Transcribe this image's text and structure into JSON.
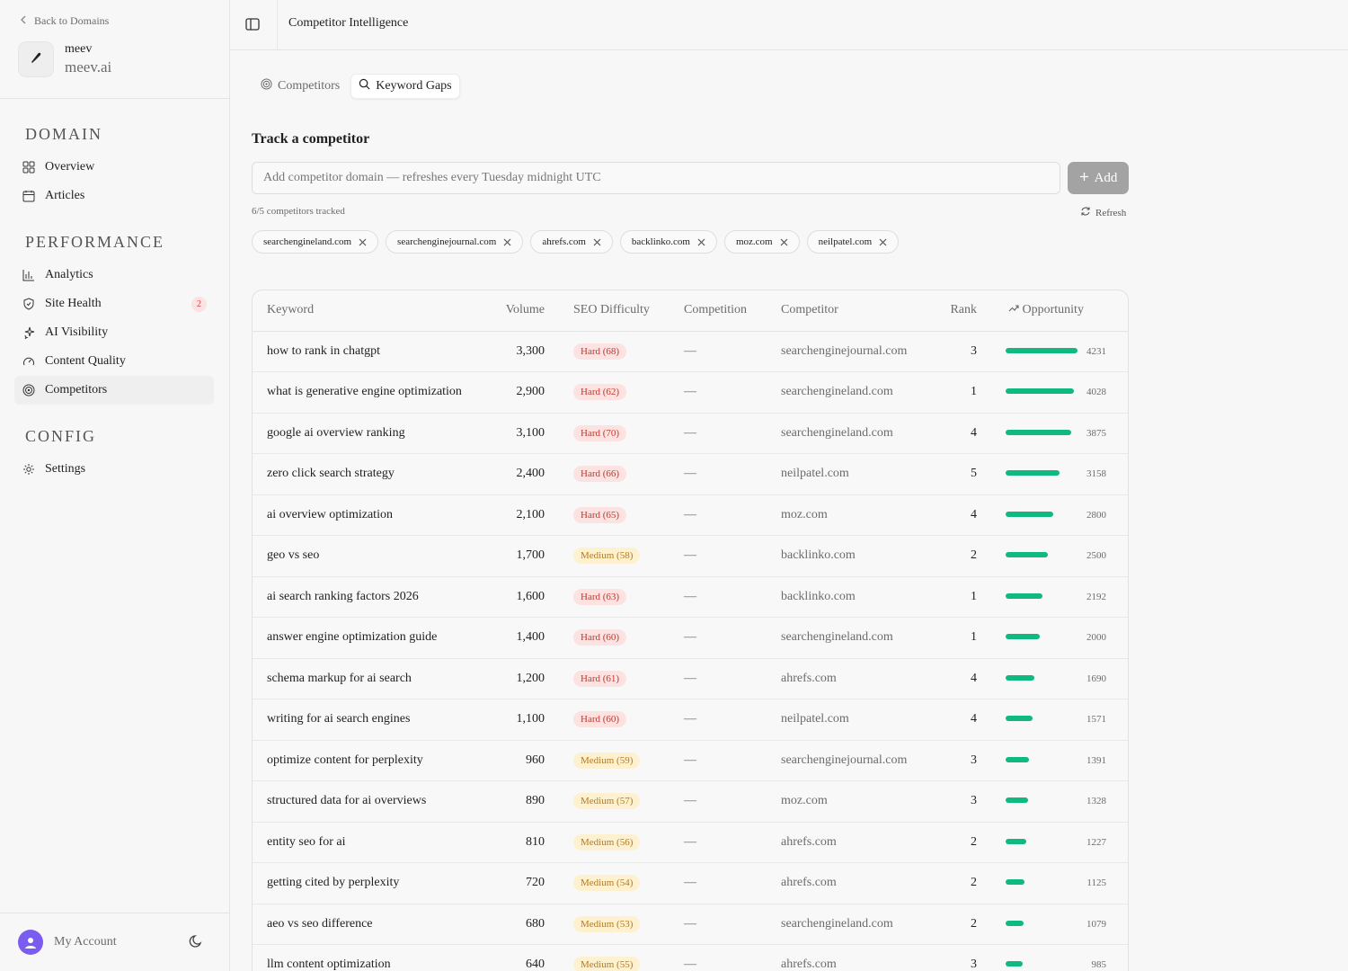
{
  "sidebar": {
    "back_label": "Back to Domains",
    "brand_name": "meev",
    "brand_domain": "meev.ai",
    "sections": {
      "domain": "DOMAIN",
      "performance": "PERFORMANCE",
      "config": "CONFIG"
    },
    "items": {
      "overview": "Overview",
      "articles": "Articles",
      "analytics": "Analytics",
      "site_health": "Site Health",
      "site_health_badge": "2",
      "ai_visibility": "AI Visibility",
      "content_quality": "Content Quality",
      "competitors": "Competitors",
      "settings": "Settings"
    },
    "account_label": "My Account"
  },
  "topbar": {
    "title": "Competitor Intelligence"
  },
  "tabs": {
    "competitors": "Competitors",
    "keyword_gaps": "Keyword Gaps",
    "active": "keyword_gaps"
  },
  "track": {
    "title": "Track a competitor",
    "placeholder": "Add competitor domain — refreshes every Tuesday midnight UTC",
    "add_label": "Add",
    "tracked_text": "6/5 competitors tracked",
    "refresh_label": "Refresh",
    "chips": [
      "searchengineland.com",
      "searchenginejournal.com",
      "ahrefs.com",
      "backlinko.com",
      "moz.com",
      "neilpatel.com"
    ]
  },
  "table": {
    "headers": {
      "keyword": "Keyword",
      "volume": "Volume",
      "seo_difficulty": "SEO Difficulty",
      "competition": "Competition",
      "competitor": "Competitor",
      "rank": "Rank",
      "opportunity": "Opportunity"
    },
    "opportunity_max": 4231,
    "rows": [
      {
        "keyword": "how to rank in chatgpt",
        "volume": "3,300",
        "difficulty": "Hard (68)",
        "level": "hard",
        "competition": "—",
        "competitor": "searchenginejournal.com",
        "rank": "3",
        "opportunity": 4231
      },
      {
        "keyword": "what is generative engine optimization",
        "volume": "2,900",
        "difficulty": "Hard (62)",
        "level": "hard",
        "competition": "—",
        "competitor": "searchengineland.com",
        "rank": "1",
        "opportunity": 4028
      },
      {
        "keyword": "google ai overview ranking",
        "volume": "3,100",
        "difficulty": "Hard (70)",
        "level": "hard",
        "competition": "—",
        "competitor": "searchengineland.com",
        "rank": "4",
        "opportunity": 3875
      },
      {
        "keyword": "zero click search strategy",
        "volume": "2,400",
        "difficulty": "Hard (66)",
        "level": "hard",
        "competition": "—",
        "competitor": "neilpatel.com",
        "rank": "5",
        "opportunity": 3158
      },
      {
        "keyword": "ai overview optimization",
        "volume": "2,100",
        "difficulty": "Hard (65)",
        "level": "hard",
        "competition": "—",
        "competitor": "moz.com",
        "rank": "4",
        "opportunity": 2800
      },
      {
        "keyword": "geo vs seo",
        "volume": "1,700",
        "difficulty": "Medium (58)",
        "level": "medium",
        "competition": "—",
        "competitor": "backlinko.com",
        "rank": "2",
        "opportunity": 2500
      },
      {
        "keyword": "ai search ranking factors 2026",
        "volume": "1,600",
        "difficulty": "Hard (63)",
        "level": "hard",
        "competition": "—",
        "competitor": "backlinko.com",
        "rank": "1",
        "opportunity": 2192
      },
      {
        "keyword": "answer engine optimization guide",
        "volume": "1,400",
        "difficulty": "Hard (60)",
        "level": "hard",
        "competition": "—",
        "competitor": "searchengineland.com",
        "rank": "1",
        "opportunity": 2000
      },
      {
        "keyword": "schema markup for ai search",
        "volume": "1,200",
        "difficulty": "Hard (61)",
        "level": "hard",
        "competition": "—",
        "competitor": "ahrefs.com",
        "rank": "4",
        "opportunity": 1690
      },
      {
        "keyword": "writing for ai search engines",
        "volume": "1,100",
        "difficulty": "Hard (60)",
        "level": "hard",
        "competition": "—",
        "competitor": "neilpatel.com",
        "rank": "4",
        "opportunity": 1571
      },
      {
        "keyword": "optimize content for perplexity",
        "volume": "960",
        "difficulty": "Medium (59)",
        "level": "medium",
        "competition": "—",
        "competitor": "searchenginejournal.com",
        "rank": "3",
        "opportunity": 1391
      },
      {
        "keyword": "structured data for ai overviews",
        "volume": "890",
        "difficulty": "Medium (57)",
        "level": "medium",
        "competition": "—",
        "competitor": "moz.com",
        "rank": "3",
        "opportunity": 1328
      },
      {
        "keyword": "entity seo for ai",
        "volume": "810",
        "difficulty": "Medium (56)",
        "level": "medium",
        "competition": "—",
        "competitor": "ahrefs.com",
        "rank": "2",
        "opportunity": 1227
      },
      {
        "keyword": "getting cited by perplexity",
        "volume": "720",
        "difficulty": "Medium (54)",
        "level": "medium",
        "competition": "—",
        "competitor": "ahrefs.com",
        "rank": "2",
        "opportunity": 1125
      },
      {
        "keyword": "aeo vs seo difference",
        "volume": "680",
        "difficulty": "Medium (53)",
        "level": "medium",
        "competition": "—",
        "competitor": "searchengineland.com",
        "rank": "2",
        "opportunity": 1079
      },
      {
        "keyword": "llm content optimization",
        "volume": "640",
        "difficulty": "Medium (55)",
        "level": "medium",
        "competition": "—",
        "competitor": "ahrefs.com",
        "rank": "3",
        "opportunity": 985
      }
    ]
  },
  "colors": {
    "accent_green": "#10b981",
    "hard_bg": "#fde2e2",
    "hard_text": "#c0392b",
    "medium_bg": "#fdf1cf",
    "medium_text": "#b7791f",
    "avatar": "#7b5cf0"
  },
  "icons": [
    "chevron-left-icon",
    "feather-icon",
    "grid-icon",
    "calendar-icon",
    "bar-chart-icon",
    "shield-icon",
    "sparkles-icon",
    "gauge-icon",
    "target-icon",
    "gear-icon",
    "moon-icon",
    "panel-icon",
    "search-icon",
    "plus-icon",
    "refresh-icon",
    "close-icon",
    "trend-up-icon"
  ]
}
